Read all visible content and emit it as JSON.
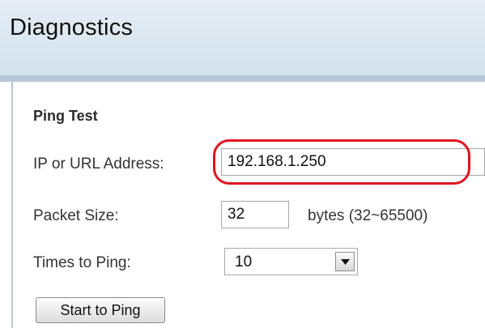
{
  "page": {
    "title": "Diagnostics"
  },
  "ping_test": {
    "section_title": "Ping Test",
    "ip_label": "IP or URL Address:",
    "ip_value": "192.168.1.250",
    "packet_size_label": "Packet Size:",
    "packet_size_value": "32",
    "packet_size_unit": "bytes (32~65500)",
    "times_label": "Times to Ping:",
    "times_value": "10",
    "start_button": "Start to Ping"
  },
  "icons": {
    "dropdown": "chevron-down-icon"
  },
  "colors": {
    "highlight": "#e0141e",
    "header": "#d3e1ec"
  }
}
